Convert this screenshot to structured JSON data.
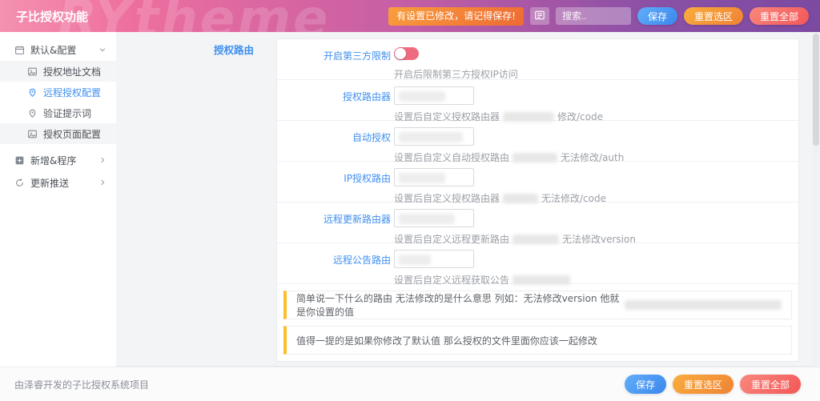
{
  "header": {
    "title": "子比授权功能",
    "watermark": "RYtheme",
    "alert_badge": "有设置已修改，请记得保存!",
    "search_placeholder": "搜索..",
    "buttons": {
      "save": "保存",
      "reset_section": "重置选区",
      "reset_all": "重置全部"
    }
  },
  "sidebar": {
    "items": [
      {
        "label": "默认&配置"
      },
      {
        "label": "授权地址文档"
      },
      {
        "label": "远程授权配置"
      },
      {
        "label": "验证提示词"
      },
      {
        "label": "授权页面配置"
      },
      {
        "label": "新增&程序"
      },
      {
        "label": "更新推送"
      }
    ]
  },
  "main": {
    "section_label": "授权路由",
    "rows": [
      {
        "label": "开启第三方限制",
        "help_before": "开启后限制第三方授权IP访问",
        "help_after": "",
        "toggle_on": false
      },
      {
        "label": "授权路由器",
        "help_before": "设置后自定义授权路由器",
        "help_after": "修改/code"
      },
      {
        "label": "自动授权",
        "help_before": "设置后自定义自动授权路由",
        "help_after": "无法修改/auth"
      },
      {
        "label": "IP授权路由",
        "help_before": "设置后自定义授权路由器",
        "help_after": "无法修改/code"
      },
      {
        "label": "远程更新路由器",
        "help_before": "设置后自定义远程更新路由",
        "help_after": "无法修改version"
      },
      {
        "label": "远程公告路由",
        "help_before": "设置后自定义远程获取公告",
        "help_after": ""
      }
    ],
    "notes": [
      "简单说一下什么的路由 无法修改的是什么意思 列如：无法修改version 他就是你设置的值",
      "值得一提的是如果你修改了默认值 那么授权的文件里面你应该一起修改"
    ]
  },
  "footer": {
    "text": "由泽睿开发的子比授权系统项目",
    "buttons": {
      "save": "保存",
      "reset_section": "重置选区",
      "reset_all": "重置全部"
    }
  },
  "colors": {
    "accent_blue": "#3f8fef",
    "accent_orange": "#ef8334",
    "accent_red": "#f25757",
    "note_accent": "#fcbe2d",
    "toggle_track": "#ef6b7f",
    "header_gradient_left": "#f491b0",
    "header_gradient_right": "#7b4aa1"
  }
}
